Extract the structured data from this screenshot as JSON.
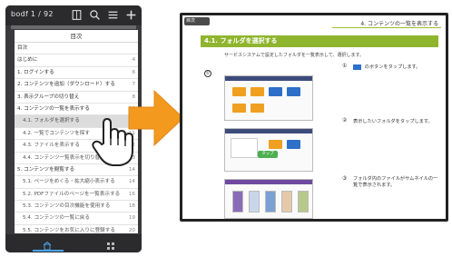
{
  "phone": {
    "title": "bodf 1 / 92",
    "toc_header": "目次",
    "toc_items": [
      {
        "label": "目次",
        "page": "",
        "sub": false,
        "hi": false
      },
      {
        "label": "はじめに",
        "page": "4",
        "sub": false,
        "hi": false
      },
      {
        "label": "1. ログインする",
        "page": "6",
        "sub": false,
        "hi": false
      },
      {
        "label": "2. コンテンツを追加（ダウンロード）する",
        "page": "7",
        "sub": false,
        "hi": false
      },
      {
        "label": "3. 表示グループの切り替え",
        "page": "8",
        "sub": false,
        "hi": false
      },
      {
        "label": "4. コンテンツの一覧を表示する",
        "page": "10",
        "sub": false,
        "hi": false
      },
      {
        "label": "4.1. フォルダを選択する",
        "page": "10",
        "sub": true,
        "hi": true
      },
      {
        "label": "4.2. 一覧でコンテンツを探す",
        "page": "11",
        "sub": true,
        "hi": false
      },
      {
        "label": "4.3. ファイルを表示する",
        "page": "12",
        "sub": true,
        "hi": false
      },
      {
        "label": "4.4. コンテンツ一覧表示を切り替える",
        "page": "13",
        "sub": true,
        "hi": false
      },
      {
        "label": "5. コンテンツを閲覧する",
        "page": "14",
        "sub": false,
        "hi": false
      },
      {
        "label": "5.1. ページをめくる・拡大縮小表示する",
        "page": "14",
        "sub": true,
        "hi": false
      },
      {
        "label": "5.2. PDFファイルのページを一覧表示する",
        "page": "16",
        "sub": true,
        "hi": false
      },
      {
        "label": "5.3. コンテンツの目次機能を使用する",
        "page": "18",
        "sub": true,
        "hi": false
      },
      {
        "label": "5.4. コンテンツの一覧に戻る",
        "page": "19",
        "sub": true,
        "hi": false
      },
      {
        "label": "5.5. コンテンツをお気に入りに登録する",
        "page": "20",
        "sub": true,
        "hi": false
      }
    ]
  },
  "tablet": {
    "menu_label": "目次",
    "header": "4. コンテンツの一覧を表示する",
    "section_title": "4.1. フォルダを選択する",
    "intro": "サービスシステムで設定したフォルダを一覧表示して、選択します。",
    "steps": [
      {
        "num": "①",
        "text": "  のボタンをタップします。"
      },
      {
        "num": "②",
        "text": "表示したいフォルダをタップします。"
      },
      {
        "num": "③",
        "text": "フォルダ内のファイルがサムネイルの一覧で表示されます。"
      }
    ],
    "tap_label": "タップ",
    "circle_label": "①"
  },
  "colors": {
    "accent_green": "#8fb52e",
    "arrow_orange": "#f39a1e",
    "phone_dark": "#2b2b2d",
    "blue": "#2d6fc9"
  },
  "icons": [
    "book-icon",
    "search-icon",
    "list-icon",
    "add-icon",
    "home-icon",
    "grid-icon",
    "hand-pointer-icon",
    "arrow-right-icon"
  ]
}
